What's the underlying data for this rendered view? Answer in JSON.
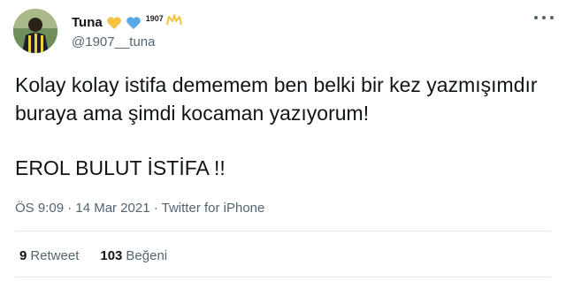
{
  "user": {
    "display_name": "Tuna",
    "handle": "@1907__tuna",
    "badge_text": "1907",
    "heart_colors": [
      "#f5c242",
      "#5aa8e6"
    ],
    "crown_color": "#f5c242"
  },
  "tweet": {
    "line1": "Kolay kolay istifa dememem ben belki bir kez yazmışımdır",
    "line2": "buraya ama şimdi kocaman yazıyorum!",
    "line3": "EROL BULUT İSTİFA !!",
    "timestamp": "ÖS 9:09 · 14 Mar 2021 · Twitter for iPhone"
  },
  "stats": {
    "retweet_count": "9",
    "retweet_label": "Retweet",
    "like_count": "103",
    "like_label": "Beğeni"
  },
  "icons": {
    "more": "more-options-icon",
    "avatar": "avatar"
  }
}
